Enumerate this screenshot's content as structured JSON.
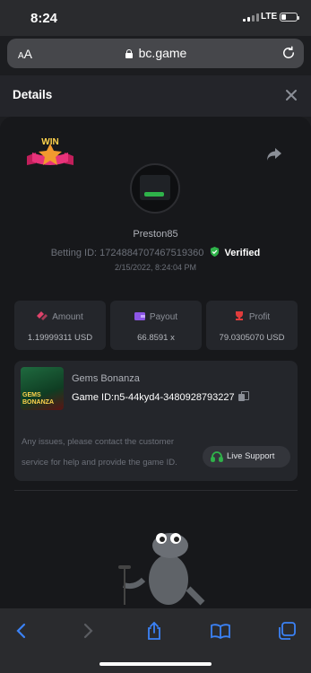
{
  "status_bar": {
    "time": "8:24",
    "network": "LTE"
  },
  "browser": {
    "text_size_label_small": "A",
    "text_size_label_large": "A",
    "url": "bc.game"
  },
  "header": {
    "title": "Details"
  },
  "badge": {
    "text": "WIN"
  },
  "player": {
    "username": "Preston85",
    "betting_id_label": "Betting ID:",
    "betting_id": "1724884707467519360",
    "verified_label": "Verified",
    "datetime": "2/15/2022, 8:24:04 PM"
  },
  "stats": [
    {
      "label": "Amount",
      "value": "1.19999311 USD",
      "icon": "coins-icon",
      "color": "#e0436b"
    },
    {
      "label": "Payout",
      "value": "66.8591 x",
      "icon": "wallet-icon",
      "color": "#8c56e6"
    },
    {
      "label": "Profit",
      "value": "79.0305070 USD",
      "icon": "trophy-icon",
      "color": "#e03c3c"
    }
  ],
  "game": {
    "thumbnail_text": "GEMS BONANZA",
    "name": "Gems Bonanza",
    "id_label": "Game ID:",
    "id": "n5-44kyd4-3480928793227",
    "issues_text": "Any issues, please contact the customer service for help and provide the game ID.",
    "support_label": "Live Support"
  },
  "colors": {
    "accent_green": "#2fb34a",
    "background": "#17181b",
    "card": "#24262b"
  }
}
